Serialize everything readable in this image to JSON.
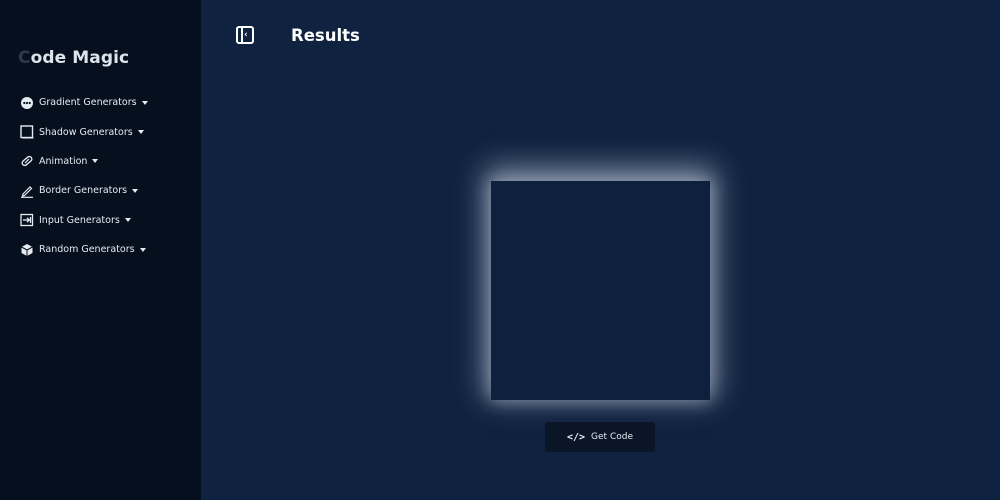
{
  "app": {
    "brand_prefix": "C",
    "brand_rest": "ode Magic"
  },
  "sidebar": {
    "items": [
      {
        "label": "Gradient Generators",
        "icon": "palette-icon"
      },
      {
        "label": "Shadow Generators",
        "icon": "shadow-box-icon"
      },
      {
        "label": "Animation",
        "icon": "pill-icon"
      },
      {
        "label": "Border Generators",
        "icon": "pen-icon"
      },
      {
        "label": "Input Generators",
        "icon": "input-arrow-icon"
      },
      {
        "label": "Random Generators",
        "icon": "cube-icon"
      }
    ]
  },
  "header": {
    "title": "Results"
  },
  "actions": {
    "get_code_label": "Get Code",
    "get_code_icon": "</>"
  },
  "colors": {
    "sidebar_bg": "#060f1d",
    "main_bg": "#0f2240",
    "preview_bg": "#0d213f",
    "button_bg": "#0a1628"
  }
}
